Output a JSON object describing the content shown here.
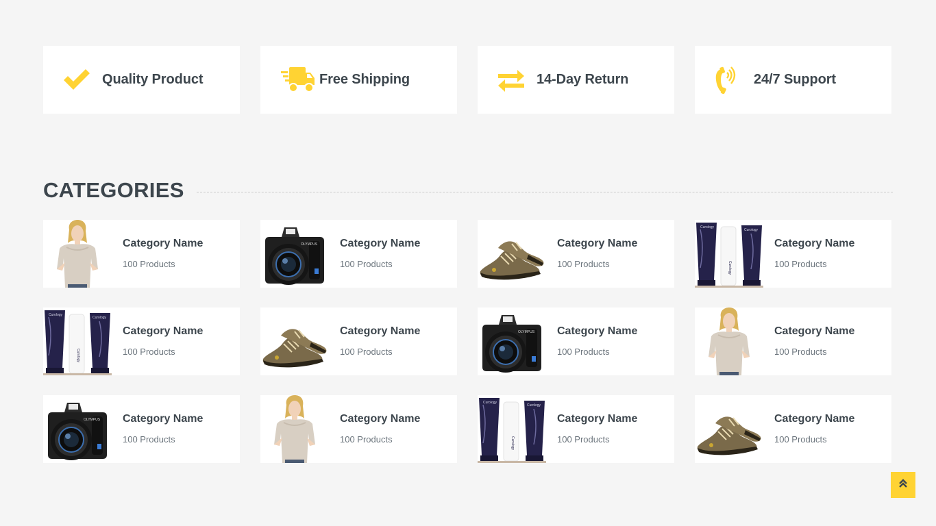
{
  "colors": {
    "accent": "#ffd333",
    "text": "#3d464d",
    "muted": "#6c757d",
    "background": "#f5f5f5"
  },
  "features": [
    {
      "label": "Quality Product",
      "icon": "check-icon"
    },
    {
      "label": "Free Shipping",
      "icon": "shipping-truck-icon"
    },
    {
      "label": "14-Day Return",
      "icon": "exchange-arrows-icon"
    },
    {
      "label": "24/7 Support",
      "icon": "phone-volume-icon"
    }
  ],
  "categories": {
    "title": "CATEGORIES",
    "items": [
      {
        "name": "Category Name",
        "count": "100 Products",
        "image": "woman-sweater"
      },
      {
        "name": "Category Name",
        "count": "100 Products",
        "image": "camera"
      },
      {
        "name": "Category Name",
        "count": "100 Products",
        "image": "shoes"
      },
      {
        "name": "Category Name",
        "count": "100 Products",
        "image": "cosmetics"
      },
      {
        "name": "Category Name",
        "count": "100 Products",
        "image": "cosmetics"
      },
      {
        "name": "Category Name",
        "count": "100 Products",
        "image": "shoes"
      },
      {
        "name": "Category Name",
        "count": "100 Products",
        "image": "camera"
      },
      {
        "name": "Category Name",
        "count": "100 Products",
        "image": "woman-sweater"
      },
      {
        "name": "Category Name",
        "count": "100 Products",
        "image": "camera"
      },
      {
        "name": "Category Name",
        "count": "100 Products",
        "image": "woman-sweater"
      },
      {
        "name": "Category Name",
        "count": "100 Products",
        "image": "cosmetics"
      },
      {
        "name": "Category Name",
        "count": "100 Products",
        "image": "shoes"
      }
    ]
  },
  "back_to_top": {
    "icon": "double-chevron-up-icon"
  }
}
